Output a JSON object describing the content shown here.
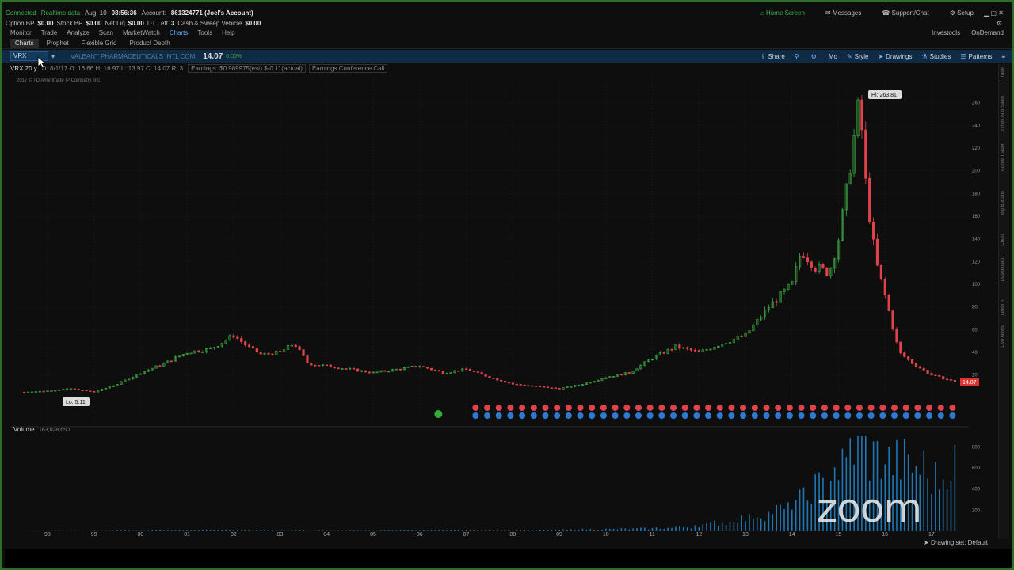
{
  "status_bar": {
    "connected": "Connected",
    "realtime": "Realtime data",
    "date": "Aug. 10",
    "time": "08:56:36",
    "account_label": "Account:",
    "account_value": "861324771 (Joel's Account)",
    "home_screen": "Home Screen",
    "messages": "Messages",
    "support": "Support/Chat",
    "setup": "Setup"
  },
  "bp_bar": {
    "option_bp_label": "Option BP",
    "option_bp": "$0.00",
    "stock_bp_label": "Stock BP",
    "stock_bp": "$0.00",
    "net_liq_label": "Net Liq",
    "net_liq": "$0.00",
    "dt_left_label": "DT Left",
    "dt_left": "3",
    "cash_label": "Cash & Sweep Vehicle",
    "cash": "$0.00"
  },
  "menu": {
    "items": [
      "Monitor",
      "Trade",
      "Analyze",
      "Scan",
      "MarketWatch",
      "Charts",
      "Tools",
      "Help"
    ],
    "right_items": [
      "Investools",
      "OnDemand"
    ]
  },
  "sub_tabs": [
    "Charts",
    "Prophet",
    "Flexible Grid",
    "Product Depth"
  ],
  "chart_toolbar": {
    "symbol": "VRX",
    "company": "VALEANT PHARMACEUTICALS INTL COM",
    "last": "14.07",
    "change": "0.00%",
    "right_buttons": [
      "Share",
      "Style",
      "Drawings",
      "Studies",
      "Patterns"
    ],
    "mo": "Mo"
  },
  "info_bar": {
    "period": "VRX 20 y",
    "ohlc": "D: 8/1/17   O: 16.66   H: 16.97   L: 13.97   C: 14.07   R: 3",
    "earnings": "Earnings: $0.989975(est) $-0.11(actual)",
    "conf": "Earnings Conference Call",
    "copyright": "2017 © TD Ameritrade IP Company, Inc."
  },
  "right_rail": [
    "Trade",
    "Times And Sales",
    "Active Trader",
    "Big Buttons",
    "Chart",
    "Dashboard",
    "Level II",
    "Live News"
  ],
  "volume_label": "Volume",
  "volume_value": "163,028,650",
  "hi_label": "Hi: 263.81",
  "lo_label": "Lo: 5.11",
  "price_marker": "14.07",
  "watermark": "zoom",
  "drawing_set": "Drawing set: Default",
  "chart_data": {
    "type": "candlestick",
    "x_ticks": [
      "98",
      "99",
      "00",
      "01",
      "02",
      "03",
      "04",
      "05",
      "06",
      "07",
      "08",
      "09",
      "10",
      "11",
      "12",
      "13",
      "14",
      "15",
      "16",
      "17"
    ],
    "price_ticks": [
      20,
      40,
      60,
      80,
      100,
      120,
      140,
      160,
      180,
      200,
      220,
      240,
      260
    ],
    "volume_ticks": [
      200,
      400,
      600,
      800
    ],
    "price_range": [
      -20,
      280
    ],
    "series": [
      {
        "name": "VRX",
        "years": [
          1997.5,
          1998,
          1998.5,
          1999,
          1999.5,
          2000,
          2000.5,
          2001,
          2001.5,
          2002,
          2002.3,
          2002.6,
          2003,
          2003.3,
          2003.6,
          2004,
          2004.5,
          2005,
          2005.5,
          2006,
          2006.5,
          2007,
          2007.5,
          2008,
          2008.5,
          2009,
          2009.5,
          2010,
          2010.5,
          2011,
          2011.5,
          2012,
          2012.5,
          2013,
          2013.5,
          2014,
          2014.2,
          2014.5,
          2014.8,
          2015,
          2015.2,
          2015.45,
          2015.6,
          2015.8,
          2016,
          2016.3,
          2016.6,
          2017,
          2017.5
        ],
        "values": [
          5,
          6,
          8,
          5,
          12,
          22,
          30,
          40,
          43,
          55,
          45,
          38,
          40,
          48,
          30,
          28,
          25,
          22,
          25,
          28,
          22,
          25,
          18,
          12,
          10,
          8,
          12,
          18,
          22,
          35,
          45,
          40,
          48,
          55,
          80,
          100,
          130,
          115,
          110,
          140,
          190,
          263.81,
          180,
          120,
          90,
          40,
          30,
          20,
          14.07
        ]
      }
    ],
    "volume": [
      2,
      2,
      3,
      2,
      3,
      5,
      4,
      6,
      8,
      12,
      10,
      8,
      6,
      6,
      5,
      4,
      4,
      5,
      4,
      5,
      6,
      8,
      10,
      10,
      8,
      8,
      10,
      12,
      14,
      18,
      20,
      22,
      25,
      30,
      40,
      60,
      80,
      120,
      160,
      200,
      300,
      420,
      600,
      800,
      700,
      650,
      600,
      500,
      650
    ]
  }
}
